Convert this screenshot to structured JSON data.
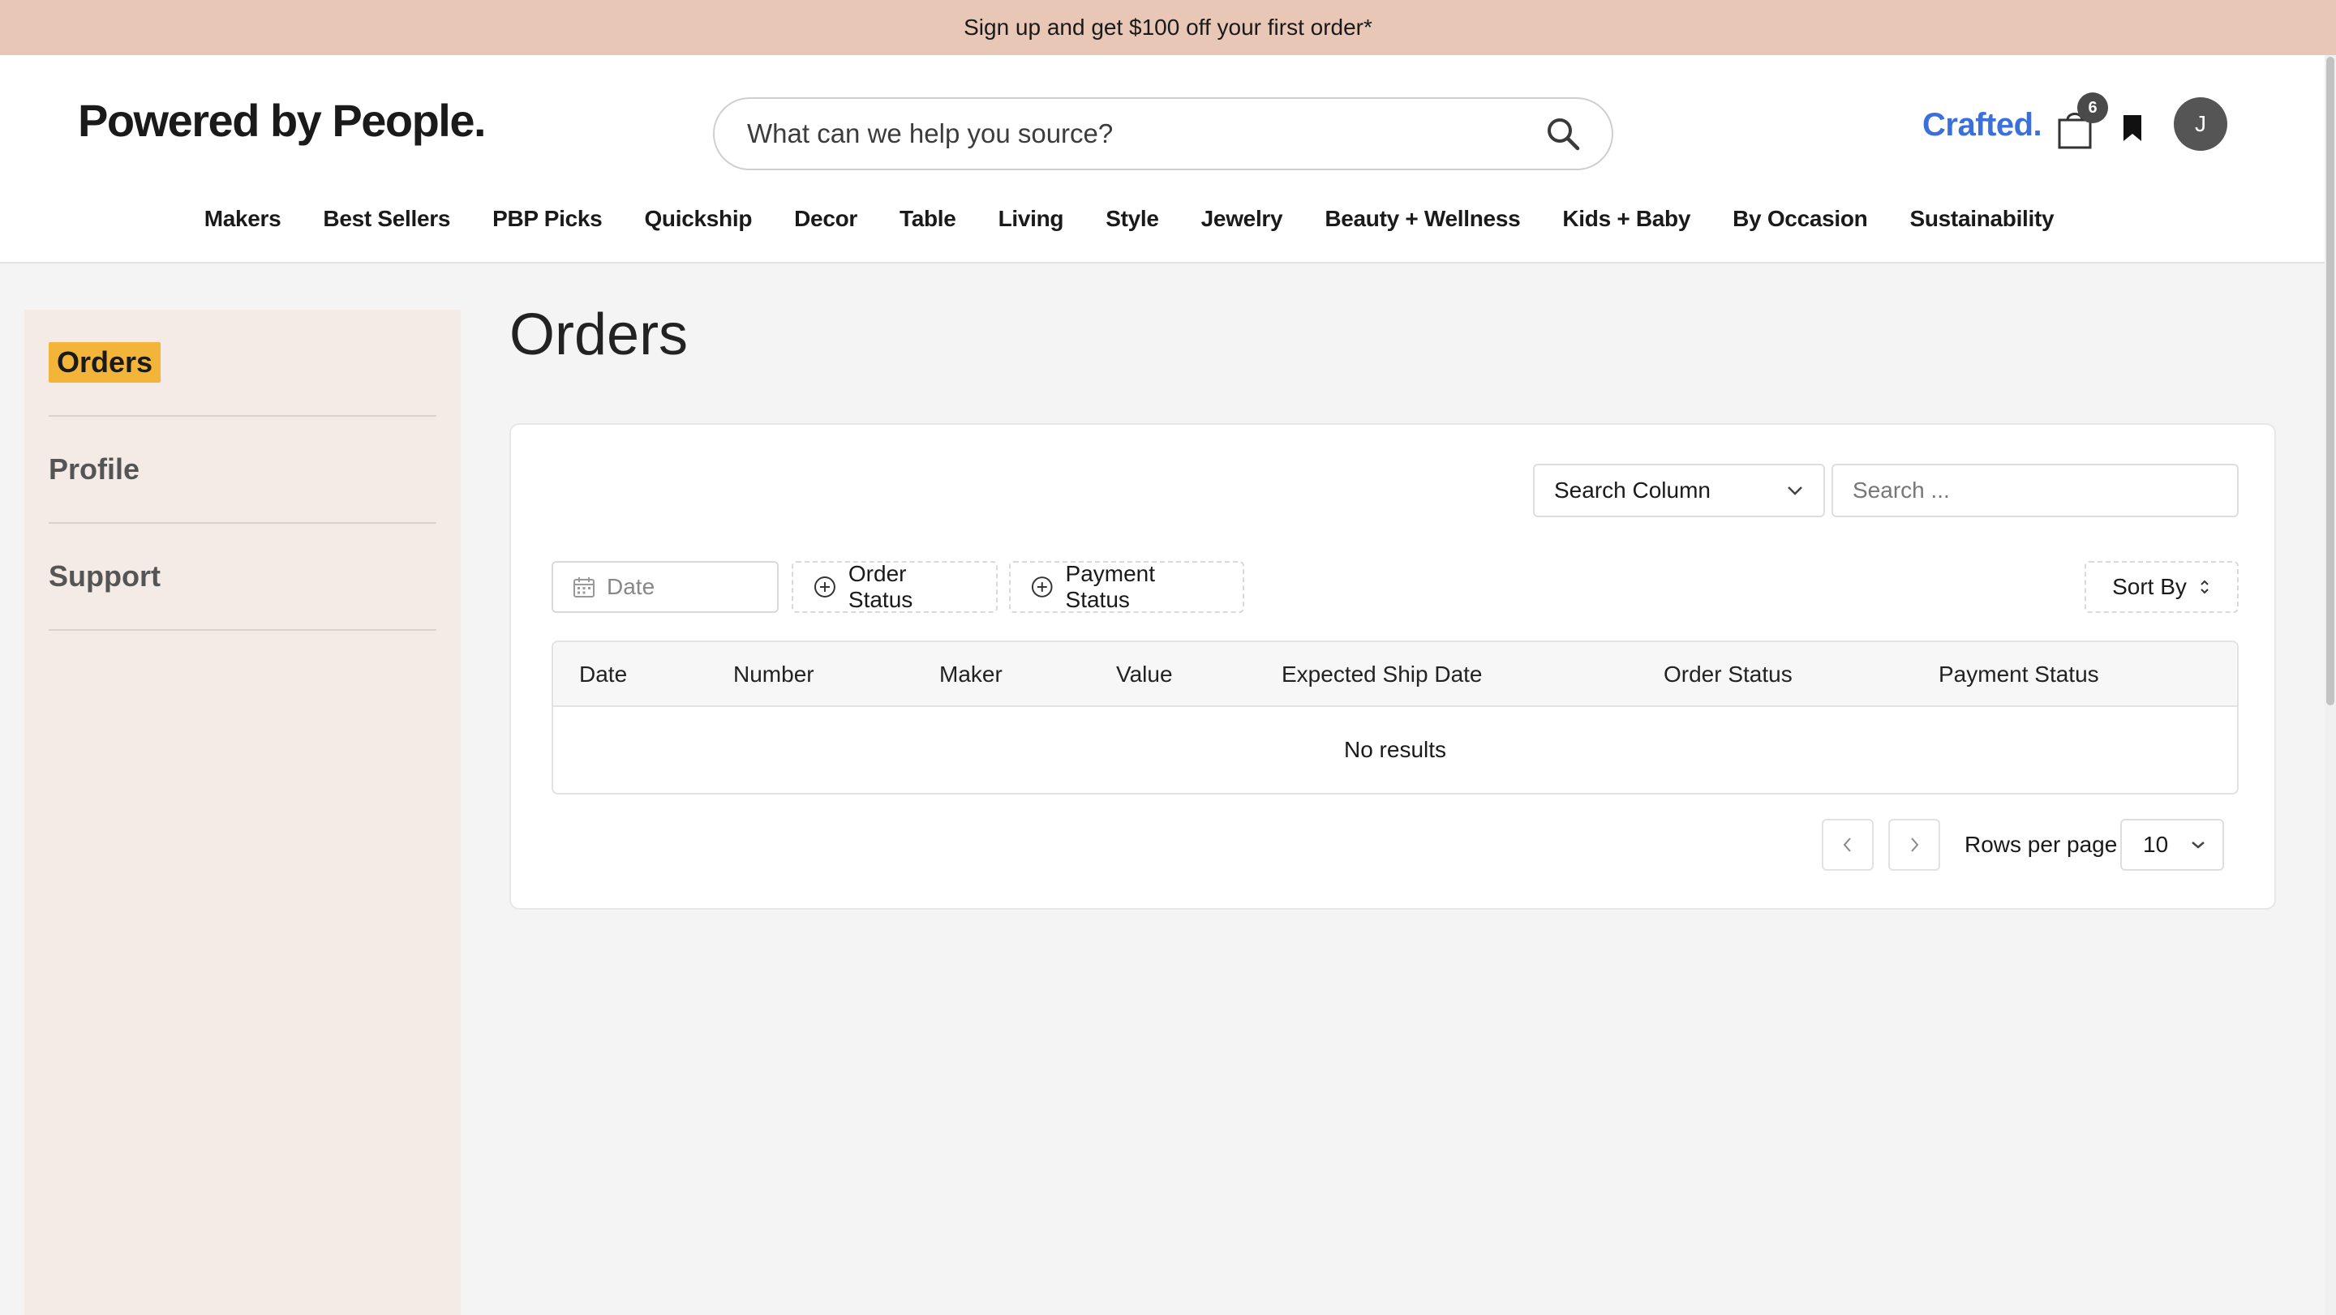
{
  "promo": {
    "text": "Sign up and get $100 off your first order*"
  },
  "header": {
    "logo": "Powered by People.",
    "search": {
      "placeholder": "What can we help you source?",
      "value": ""
    },
    "crafted": "Crafted.",
    "cart_count": "6",
    "avatar_initial": "J"
  },
  "nav": {
    "items": [
      "Makers",
      "Best Sellers",
      "PBP Picks",
      "Quickship",
      "Decor",
      "Table",
      "Living",
      "Style",
      "Jewelry",
      "Beauty + Wellness",
      "Kids + Baby",
      "By Occasion",
      "Sustainability"
    ]
  },
  "sidebar": {
    "items": [
      {
        "label": "Orders",
        "active": true
      },
      {
        "label": "Profile",
        "active": false
      },
      {
        "label": "Support",
        "active": false
      }
    ]
  },
  "main": {
    "title": "Orders",
    "search_column": "Search Column",
    "search": {
      "placeholder": "Search ...",
      "value": ""
    },
    "filters": {
      "date": "Date",
      "order_status": "Order Status",
      "payment_status": "Payment Status",
      "sort": "Sort By"
    },
    "table": {
      "columns": [
        "Date",
        "Number",
        "Maker",
        "Value",
        "Expected Ship Date",
        "Order Status",
        "Payment Status"
      ],
      "empty_text": "No results"
    },
    "pagination": {
      "rows_label": "Rows per page",
      "rows_value": "10"
    }
  },
  "colors": {
    "promo_bg": "#e8c7b6",
    "sidebar_bg": "#f5ebe6",
    "active_highlight": "#f2b53a",
    "crafted_blue": "#3a6fdc"
  },
  "icons": [
    "search-icon",
    "cart-icon",
    "bookmark-icon",
    "calendar-icon",
    "plus-circle-icon",
    "chevron-down-icon",
    "sort-icon",
    "chevron-left-icon",
    "chevron-right-icon"
  ]
}
